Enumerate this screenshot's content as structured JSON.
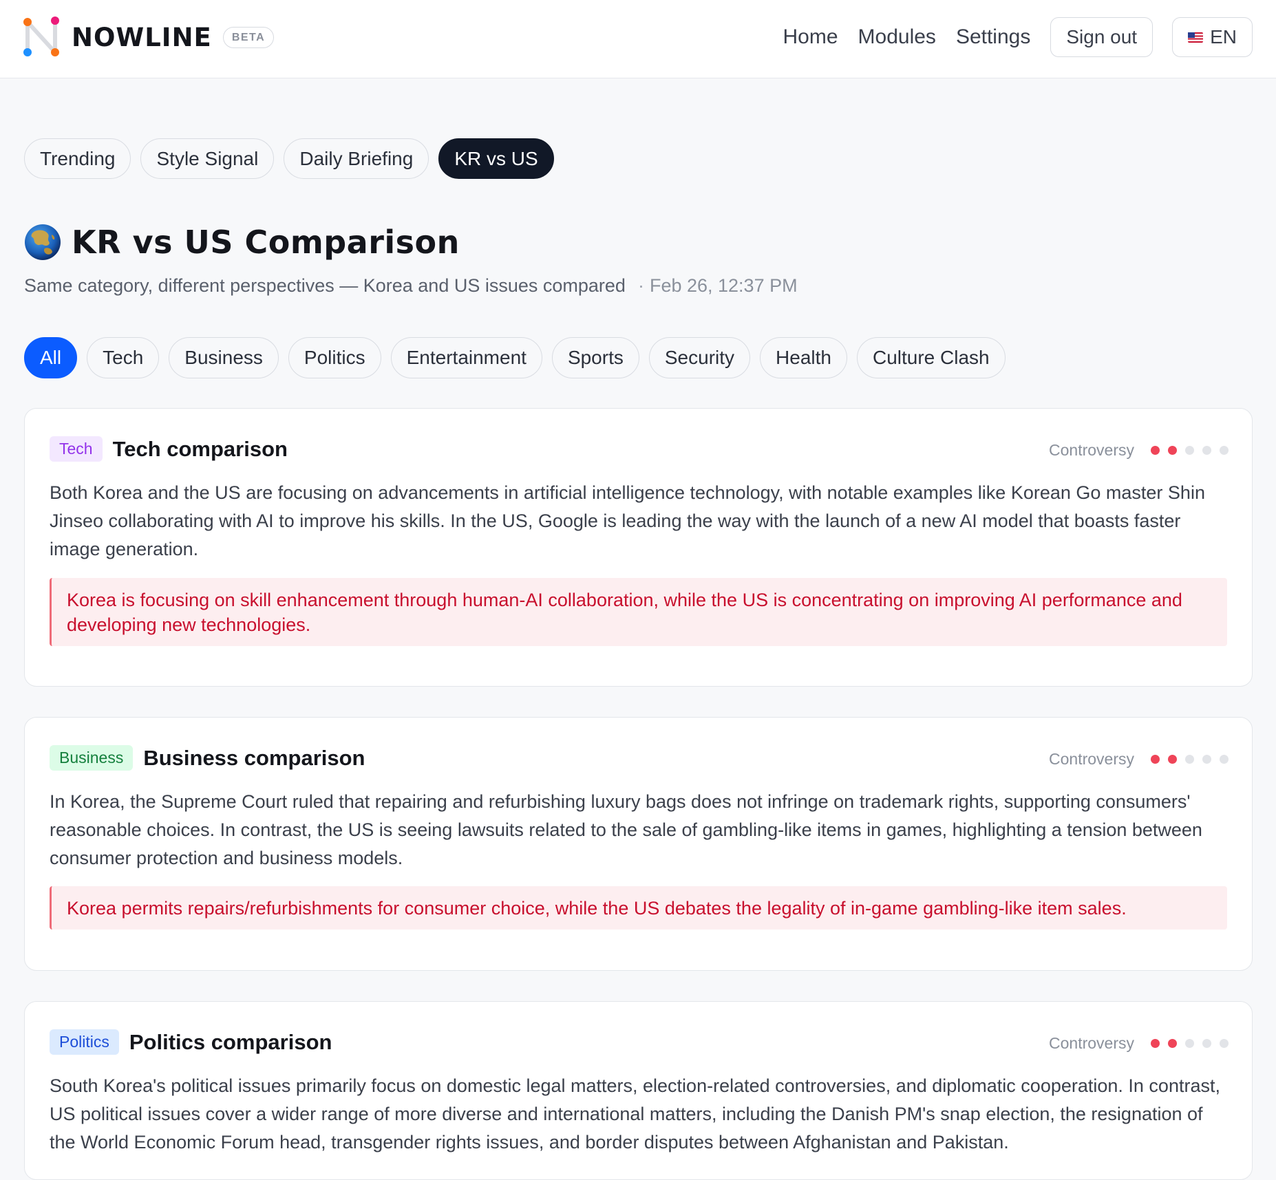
{
  "header": {
    "brand": "NOWLINE",
    "badge": "BETA",
    "nav": {
      "home": "Home",
      "modules": "Modules",
      "settings": "Settings",
      "sign_out": "Sign out",
      "language": "EN"
    }
  },
  "module_tabs": [
    "Trending",
    "Style Signal",
    "Daily Briefing",
    "KR vs US"
  ],
  "module_tabs_active": "KR vs US",
  "page": {
    "title": "KR vs US Comparison",
    "subtitle": "Same category, different perspectives — Korea and US issues compared",
    "separator": "·",
    "updated": "Feb 26, 12:37 PM"
  },
  "categories": [
    "All",
    "Tech",
    "Business",
    "Politics",
    "Entertainment",
    "Sports",
    "Security",
    "Health",
    "Culture Clash"
  ],
  "categories_active": "All",
  "cards": [
    {
      "tag": "Tech",
      "title": "Tech comparison",
      "controversy_label": "Controversy",
      "controversy_level": 2,
      "controversy_max": 5,
      "body": "Both Korea and the US are focusing on advancements in artificial intelligence technology, with notable examples like Korean Go master Shin Jinseo collaborating with AI to improve his skills. In the US, Google is leading the way with the launch of a new AI model that boasts faster image generation.",
      "insight": "Korea is focusing on skill enhancement through human-AI collaboration, while the US is concentrating on improving AI performance and developing new technologies."
    },
    {
      "tag": "Business",
      "title": "Business comparison",
      "controversy_label": "Controversy",
      "controversy_level": 2,
      "controversy_max": 5,
      "body": "In Korea, the Supreme Court ruled that repairing and refurbishing luxury bags does not infringe on trademark rights, supporting consumers' reasonable choices. In contrast, the US is seeing lawsuits related to the sale of gambling-like items in games, highlighting a tension between consumer protection and business models.",
      "insight": "Korea permits repairs/refurbishments for consumer choice, while the US debates the legality of in-game gambling-like item sales."
    },
    {
      "tag": "Politics",
      "title": "Politics comparison",
      "controversy_label": "Controversy",
      "controversy_level": 2,
      "controversy_max": 5,
      "body": "South Korea's political issues primarily focus on domestic legal matters, election-related controversies, and diplomatic cooperation. In contrast, US political issues cover a wider range of more diverse and international matters, including the Danish PM's snap election, the resignation of the World Economic Forum head, transgender rights issues, and border disputes between Afghanistan and Pakistan."
    }
  ],
  "colors": {
    "accent_blue": "#0b5cff",
    "active_dark": "#111827",
    "controversy_on": "#ef4458",
    "insight_text": "#c8102e"
  }
}
